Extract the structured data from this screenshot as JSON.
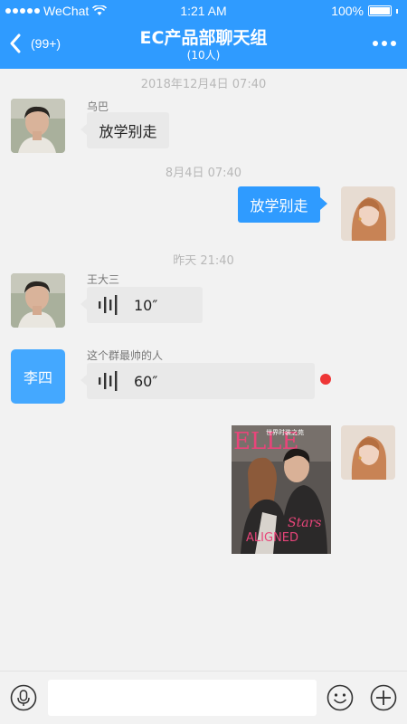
{
  "status_bar": {
    "carrier": "WeChat",
    "time": "1:21 AM",
    "battery": "100%"
  },
  "header": {
    "back_count": "(99+)",
    "title": "EC产品部聊天组",
    "subtitle": "(10人)"
  },
  "messages": {
    "time1": "2018年12月4日 07:40",
    "msg1": {
      "sender": "乌巴",
      "text": "放学别走"
    },
    "time2": "8月4日 07:40",
    "msg2": {
      "text": "放学别走"
    },
    "time3": "昨天 21:40",
    "msg3": {
      "sender": "王大三",
      "duration": "10″"
    },
    "msg4": {
      "sender": "这个群最帅的人",
      "avatar_text": "李四",
      "duration": "60″"
    },
    "magazine": {
      "brand": "ELLE",
      "tagline": "世界时装之苑",
      "cover_line_1": "Stars",
      "cover_line_2": "ALIGNED"
    }
  },
  "input": {
    "placeholder": ""
  },
  "colors": {
    "accent": "#2f9bff",
    "unread": "#ee3636",
    "bubble_in": "#e9e9e9"
  }
}
